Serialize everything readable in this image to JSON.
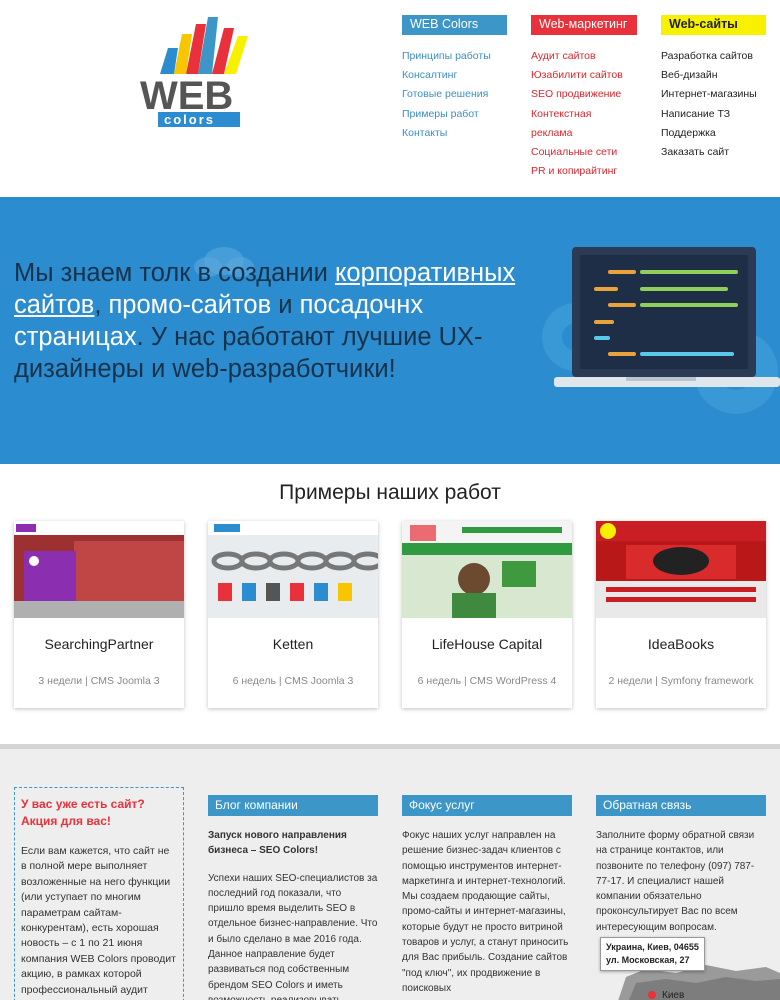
{
  "logo": {
    "text_main": "WEB",
    "text_sub": "colors"
  },
  "menu": {
    "col1": {
      "title": "WEB Colors",
      "items": [
        "Принципы работы",
        "Консалтинг",
        "Готовые решения",
        "Примеры работ",
        "Контакты"
      ]
    },
    "col2": {
      "title": "Web-маркетинг",
      "items": [
        "Аудит сайтов",
        "Юзабилити сайтов",
        "SEO продвижение",
        "Контекстная",
        "реклама",
        "Социальные сети",
        "PR и копирайтинг"
      ]
    },
    "col3": {
      "title": "Web-сайты",
      "items": [
        "Разработка сайтов",
        "Веб-дизайн",
        "Интернет-магазины",
        "Написание ТЗ",
        "Поддержка",
        "Заказать сайт"
      ]
    }
  },
  "hero": {
    "t1": "Мы знаем толк в создании ",
    "l1": "корпоративных сайтов",
    "t2": ", ",
    "l2": "промо-сайтов",
    "t3": " и ",
    "l3": "посадочнх страницах",
    "t4": ". У нас работают лучшие UX-дизайнеры и web-разработчики!"
  },
  "portfolio": {
    "title": "Примеры наших работ",
    "cards": [
      {
        "name": "SearchingPartner",
        "meta": "3 недели | CMS Joomla 3"
      },
      {
        "name": "Ketten",
        "meta": "6 недель | CMS Joomla 3"
      },
      {
        "name": "LifeHouse Capital",
        "meta": "6 недель | CMS WordPress 4"
      },
      {
        "name": "IdeaBooks",
        "meta": "2 недели | Symfony framework"
      }
    ]
  },
  "promo": {
    "title": "У вас уже есть сайт? Акция для вас!",
    "text": "Если вам кажется, что сайт не в полной мере выполняет возложенные на него функции (или уступает по многим параметрам сайтам-конкурентам), есть хорошая новость – с 1 по 21 июня компания WEB Colors проводит акцию, в рамках которой профессиональный аудит вашего сайта мы"
  },
  "blog": {
    "title": "Блог компании",
    "headline": "Запуск нового направления бизнеса – SEO Colors!",
    "text": "Успехи наших SEO-специалистов за последний год показали, что пришло время выделить SEO в отдельное бизнес-направление. Что и было сделано в мае 2016 года. Данное направление будет развиваться под собственным брендом SEO Colors и иметь возможность реализовывать"
  },
  "focus": {
    "title": "Фокус услуг",
    "text": "Фокус наших услуг направлен на решение бизнес-задач клиентов с помощью инструментов интернет-маркетинга и интернет-технологий. Мы создаем продающие сайты, промо-сайты и интернет-магазины, которые будут не просто витриной товаров и услуг, а станут приносить для Вас прибыль. Создание сайтов \"под ключ\", их продвижение в поисковых"
  },
  "feedback": {
    "title": "Обратная связь",
    "text": "Заполните форму обратной связи на странице контактов, или позвоните по телефону (097) 787-77-17. И специалист нашей компании обязательно проконсультирует Вас по всем интересующим вопросам.",
    "map_line1": "Украина, Киев, 04655",
    "map_line2": "ул. Московская, 27",
    "map_city": "Киев"
  },
  "colors": {
    "blue": "#3d96c8",
    "red": "#e8313a",
    "yellow": "#f7f100",
    "hero_bg": "#2b8dcf"
  }
}
